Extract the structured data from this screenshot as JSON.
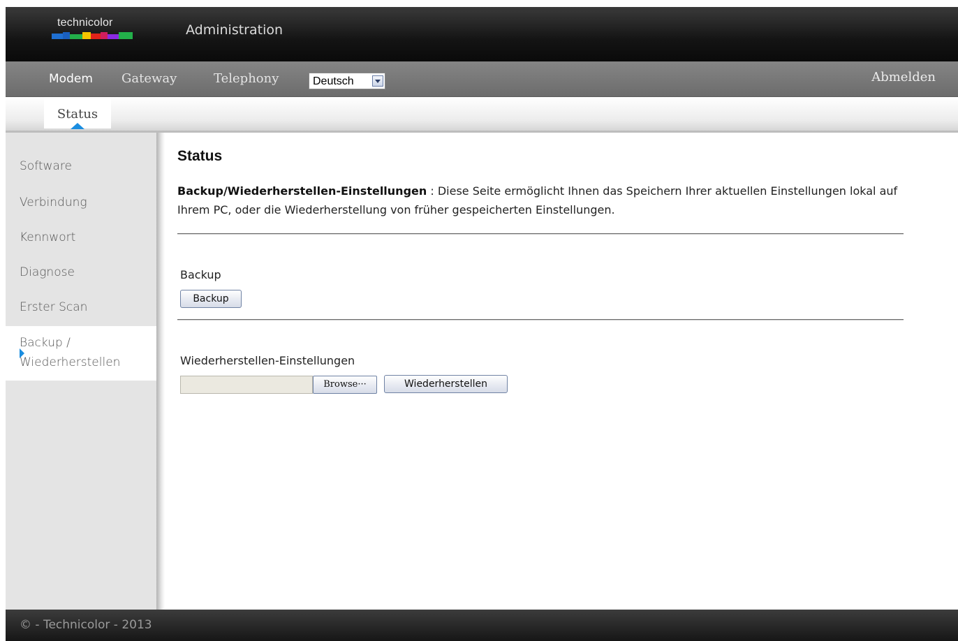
{
  "header": {
    "brand": "technicolor",
    "title": "Administration",
    "brand_colors": [
      "#1f6fd1",
      "#23b04a",
      "#f5c400",
      "#e2231a",
      "#8a2be2"
    ]
  },
  "nav": {
    "items": [
      {
        "label": "Modem",
        "active": true
      },
      {
        "label": "Gateway",
        "active": false
      },
      {
        "label": "Telephony",
        "active": false
      }
    ],
    "language": {
      "selected": "Deutsch"
    },
    "logout_label": "Abmelden"
  },
  "subnav": {
    "tabs": [
      {
        "label": "Status",
        "active": true
      }
    ]
  },
  "sidebar": {
    "items": [
      {
        "label": "Software"
      },
      {
        "label": "Verbindung"
      },
      {
        "label": "Kennwort"
      },
      {
        "label": "Diagnose"
      },
      {
        "label": "Erster Scan"
      },
      {
        "label_line1": "Backup /",
        "label_line2": "Wiederherstellen",
        "selected": true
      }
    ]
  },
  "main": {
    "title": "Status",
    "description_heading": "Backup/Wiederherstellen-Einstellungen",
    "description_separator": " :",
    "description_text": " Diese Seite ermöglicht Ihnen das Speichern Ihrer aktuellen Einstellungen lokal auf Ihrem PC, oder die Wiederherstellung von früher gespeicherten Einstellungen.",
    "backup": {
      "label": "Backup",
      "button_label": "Backup"
    },
    "restore": {
      "label": "Wiederherstellen-Einstellungen",
      "file_value": "",
      "browse_label": "Browse···",
      "button_label": "Wiederherstellen"
    }
  },
  "footer": {
    "text": "© - Technicolor - 2013"
  },
  "colors": {
    "accent": "#1a8de0"
  }
}
